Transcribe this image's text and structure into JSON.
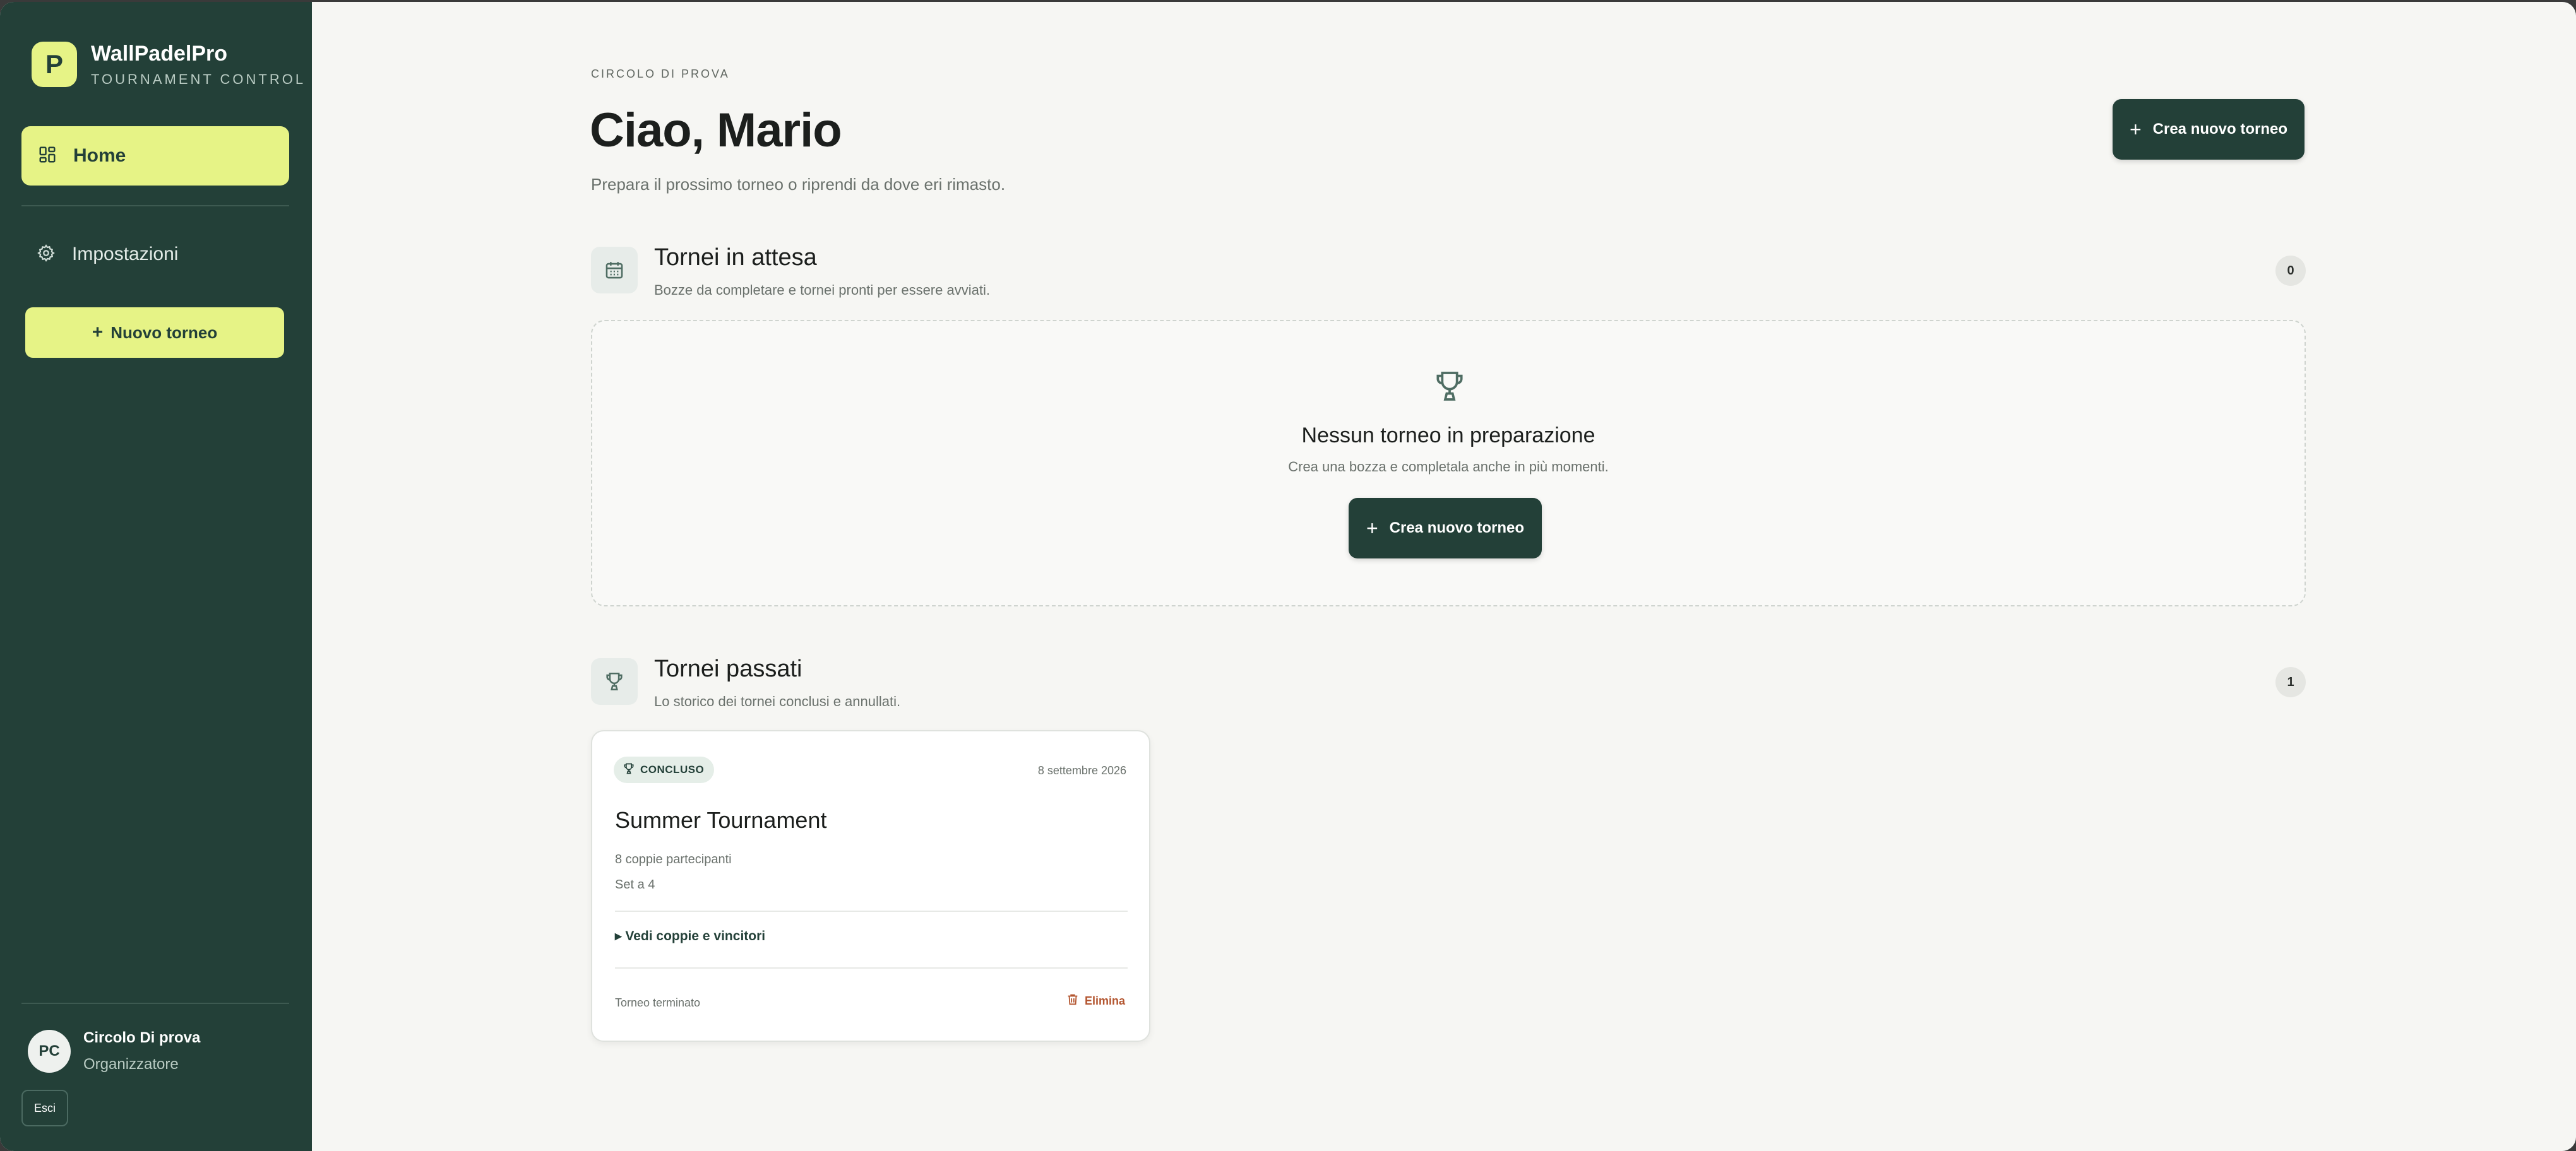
{
  "sidebar": {
    "brand_initial": "P",
    "brand_name": "WallPadelPro",
    "brand_subtitle": "TOURNAMENT CONTROL",
    "nav_home": "Home",
    "nav_settings": "Impostazioni",
    "new_button": "Nuovo torneo",
    "user_initials": "PC",
    "user_name": "Circolo Di prova",
    "user_role": "Organizzatore",
    "logout": "Esci"
  },
  "header": {
    "eyebrow": "CIRCOLO DI PROVA",
    "title": "Ciao, Mario",
    "subtitle": "Prepara il prossimo torneo o riprendi da dove eri rimasto.",
    "cta": "Crea nuovo torneo"
  },
  "pending": {
    "title": "Tornei in attesa",
    "description": "Bozze da completare e tornei pronti per essere avviati.",
    "count": "0",
    "empty_title": "Nessun torneo in preparazione",
    "empty_description": "Crea una bozza e completala anche in più momenti.",
    "empty_cta": "Crea nuovo torneo"
  },
  "past": {
    "title": "Tornei passati",
    "description": "Lo storico dei tornei conclusi e annullati.",
    "count": "1",
    "cards": [
      {
        "status": "CONCLUSO",
        "date": "8 settembre 2026",
        "title": "Summer Tournament",
        "pairs": "8 coppie partecipanti",
        "format": "Set a 4",
        "details": "▸ Vedi coppie e vincitori",
        "footer": "Torneo terminato",
        "delete": "Elimina"
      }
    ]
  },
  "colors": {
    "sidebar_bg": "#234038",
    "accent": "#e6f386",
    "page_bg": "#f6f6f3",
    "danger": "#b3552f"
  },
  "icons": [
    "grid-icon",
    "gear-icon",
    "plus-icon",
    "calendar-icon",
    "trophy-icon",
    "trash-icon"
  ]
}
